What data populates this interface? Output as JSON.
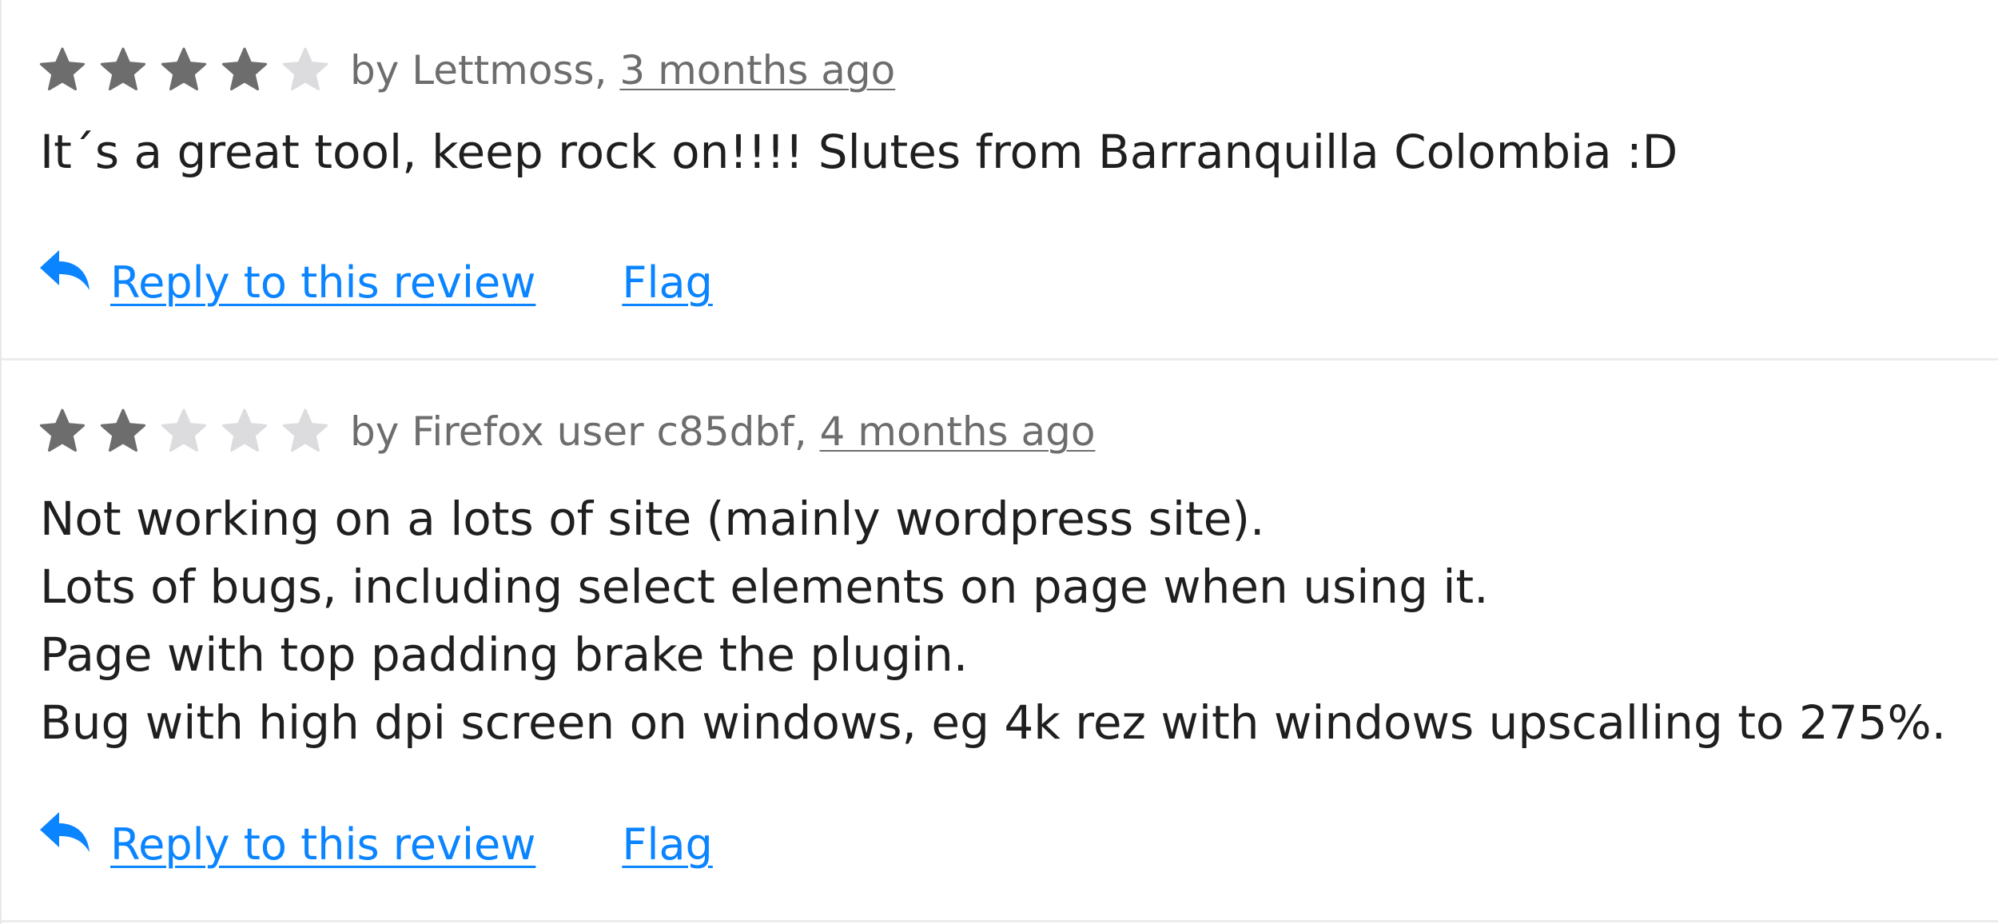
{
  "colors": {
    "star_filled": "#6d6d6d",
    "star_empty": "#dcdcdf",
    "link": "#0a84ff",
    "byline": "#6d6d6d",
    "text": "#1f1f1f"
  },
  "reviews": [
    {
      "rating": 4,
      "rating_max": 5,
      "byline_prefix": "by Lettmoss, ",
      "date": "3 months ago",
      "body": "It´s a great tool, keep rock on!!!! Slutes from Barranquilla Colombia :D",
      "reply_label": "Reply to this review",
      "flag_label": "Flag",
      "reply_icon": "reply-arrow-icon"
    },
    {
      "rating": 2,
      "rating_max": 5,
      "byline_prefix": "by Firefox user c85dbf, ",
      "date": "4 months ago",
      "body": "Not working on a lots of site (mainly wordpress site).\nLots of bugs, including select elements on page when using it.\nPage with top padding brake the plugin.\nBug with high dpi screen on windows, eg 4k rez with windows upscalling to 275%.",
      "reply_label": "Reply to this review",
      "flag_label": "Flag",
      "reply_icon": "reply-arrow-icon"
    }
  ]
}
